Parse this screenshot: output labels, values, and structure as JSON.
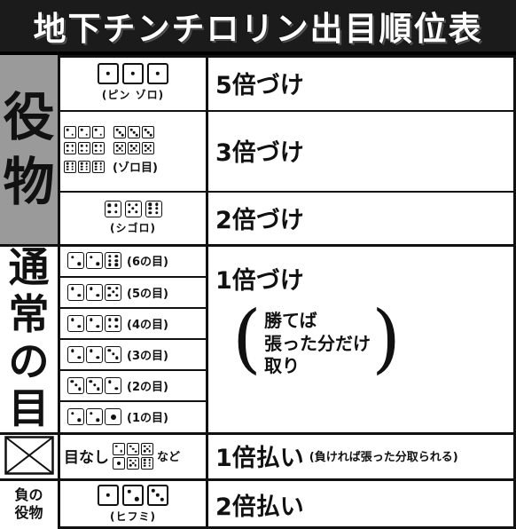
{
  "title": "地下チンチロリン出目順位表",
  "sections": {
    "yaku_label": [
      "役",
      "物"
    ],
    "tsujo_label": [
      "通",
      "常",
      "の",
      "目"
    ],
    "make_label": [
      "負の",
      "役物"
    ]
  },
  "rows": {
    "pinzoro": {
      "caption": "(ピン ゾロ)",
      "payout": "5倍づけ"
    },
    "zoro": {
      "caption": "(ゾロ目)",
      "payout": "3倍づけ"
    },
    "shigoro": {
      "caption": "(シゴロ)",
      "payout": "2倍づけ"
    },
    "six": {
      "caption": "(6の目)"
    },
    "five": {
      "caption": "(5の目)"
    },
    "four": {
      "caption": "(4の目)"
    },
    "three": {
      "caption": "(3の目)"
    },
    "two": {
      "caption": "(2の目)"
    },
    "one": {
      "caption": "(1の目)"
    },
    "tsujo_payout": "1倍づけ",
    "tsujo_note": [
      "勝てば",
      "張った分だけ",
      "取り"
    ],
    "menashi": {
      "label": "目なし",
      "suffix": "など",
      "payout": "1倍払い",
      "note": "(負ければ張った分取られる)"
    },
    "hifumi": {
      "caption": "(ヒフミ)",
      "payout": "2倍払い"
    }
  }
}
